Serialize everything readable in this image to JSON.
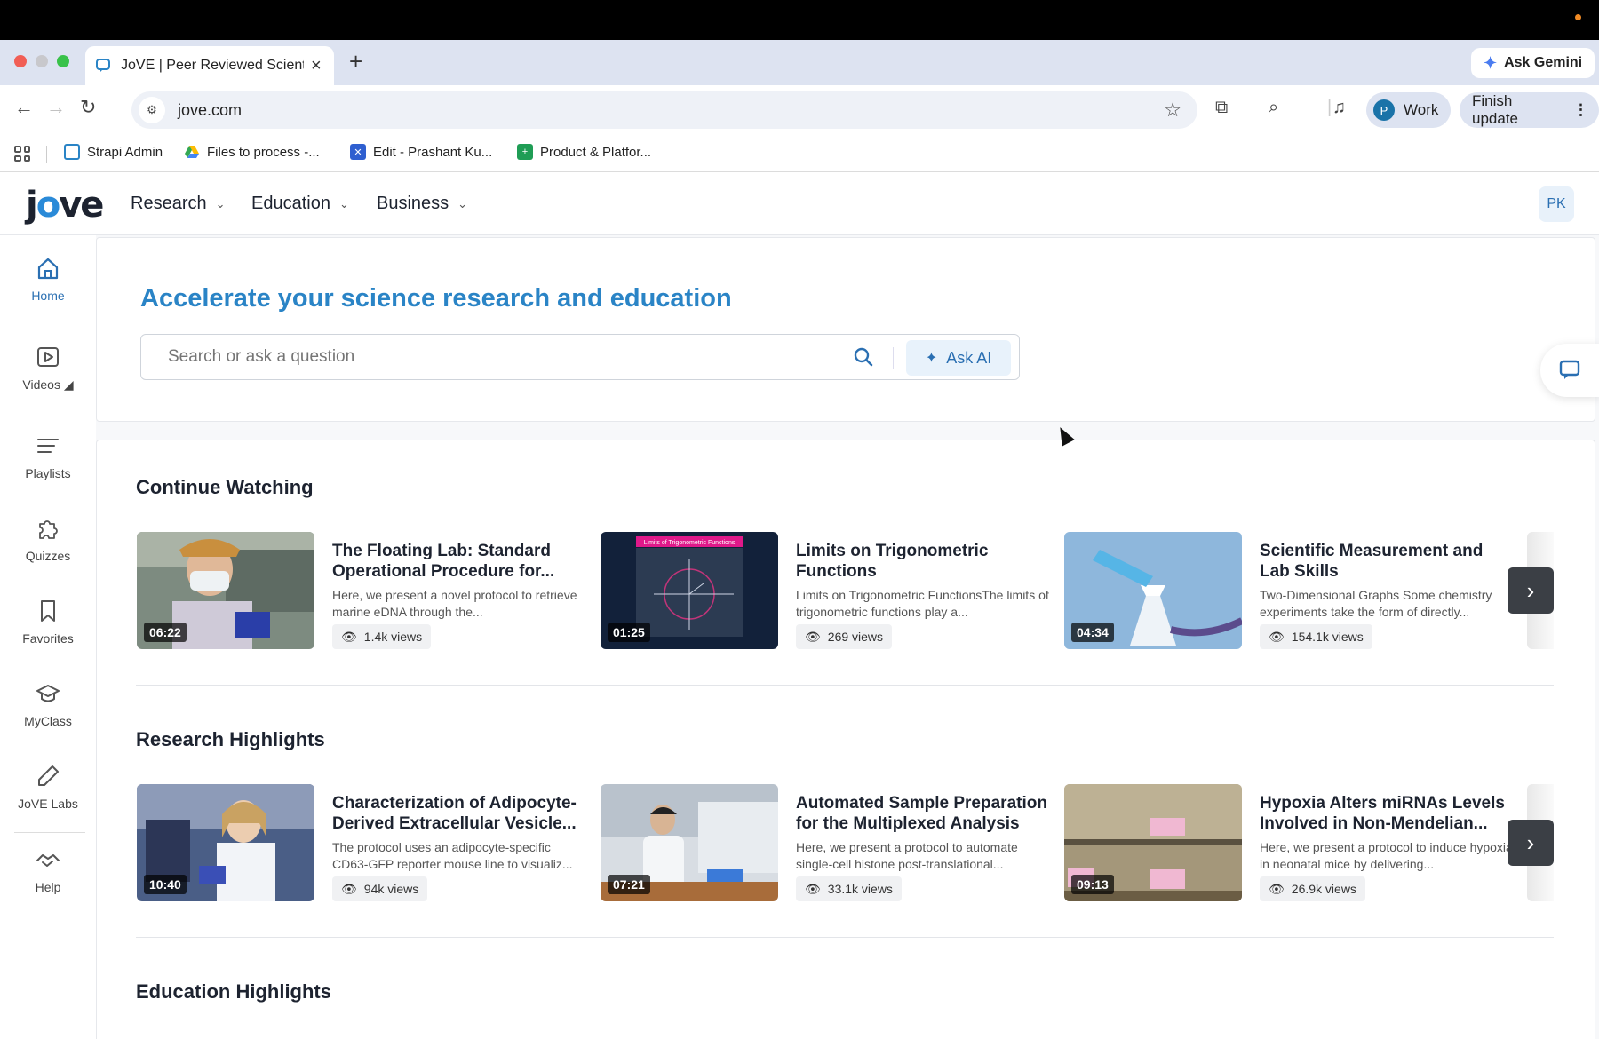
{
  "browser": {
    "tab_title": "JoVE | Peer Reviewed Scientific",
    "url": "jove.com",
    "ask_gemini": "Ask Gemini",
    "profile_initial": "P",
    "profile_label": "Work",
    "finish_update": "Finish update",
    "bookmarks": [
      {
        "label": "Strapi Admin"
      },
      {
        "label": "Files to process -..."
      },
      {
        "label": "Edit - Prashant Ku..."
      },
      {
        "label": "Product & Platfor..."
      }
    ]
  },
  "site": {
    "logo": "jove",
    "nav": [
      {
        "label": "Research"
      },
      {
        "label": "Education"
      },
      {
        "label": "Business"
      }
    ],
    "user_initials": "PK"
  },
  "sidebar": {
    "items": [
      {
        "label": "Home",
        "icon": "home-icon"
      },
      {
        "label": "Videos",
        "icon": "video-icon"
      },
      {
        "label": "Playlists",
        "icon": "playlist-icon"
      },
      {
        "label": "Quizzes",
        "icon": "puzzle-icon"
      },
      {
        "label": "Favorites",
        "icon": "bookmark-icon"
      },
      {
        "label": "MyClass",
        "icon": "graduation-cap-icon"
      },
      {
        "label": "JoVE Labs",
        "icon": "pen-icon"
      },
      {
        "label": "Help",
        "icon": "handshake-icon"
      }
    ]
  },
  "hero": {
    "title": "Accelerate your science research and education",
    "search_placeholder": "Search or ask a question",
    "ask_ai": "Ask AI"
  },
  "sections": [
    {
      "title": "Continue Watching",
      "cards": [
        {
          "title": "The Floating Lab: Standard Operational Procedure for...",
          "desc": "Here, we present a novel protocol to retrieve marine eDNA through the...",
          "duration": "06:22",
          "views": "1.4k views"
        },
        {
          "title": "Limits on Trigonometric Functions",
          "desc": "Limits on Trigonometric FunctionsThe limits of trigonometric functions play a...",
          "duration": "01:25",
          "views": "269 views"
        },
        {
          "title": "Scientific Measurement and Lab Skills",
          "desc": "Two-Dimensional Graphs Some chemistry experiments take the form of directly...",
          "duration": "04:34",
          "views": "154.1k views"
        }
      ]
    },
    {
      "title": "Research Highlights",
      "cards": [
        {
          "title": "Characterization of Adipocyte-Derived Extracellular Vesicle...",
          "desc": "The protocol uses an adipocyte-specific CD63-GFP reporter mouse line to visualiz...",
          "duration": "10:40",
          "views": "94k views"
        },
        {
          "title": "Automated Sample Preparation for the Multiplexed Analysis of...",
          "desc": "Here, we present a protocol to automate single-cell histone post-translational...",
          "duration": "07:21",
          "views": "33.1k views"
        },
        {
          "title": "Hypoxia Alters miRNAs Levels Involved in Non-Mendelian...",
          "desc": "Here, we present a protocol to induce hypoxia in neonatal mice by delivering...",
          "duration": "09:13",
          "views": "26.9k views"
        }
      ]
    },
    {
      "title": "Education Highlights"
    }
  ],
  "thumbnail_texts": {
    "trig_label": "Limits of Trigonometric Functions"
  },
  "colors": {
    "accent": "#2a84c6",
    "active_nav": "#2a6fb2",
    "next_button": "#3b3f45"
  }
}
